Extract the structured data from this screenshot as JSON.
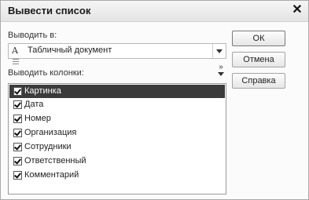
{
  "window": {
    "title": "Вывести список"
  },
  "output": {
    "label": "Выводить в:",
    "value": "Табличный документ",
    "icon": "spreadsheet-doc-icon"
  },
  "columns": {
    "label": "Выводить колонки:",
    "items": [
      {
        "label": "Картинка",
        "checked": true,
        "selected": true
      },
      {
        "label": "Дата",
        "checked": true
      },
      {
        "label": "Номер",
        "checked": true
      },
      {
        "label": "Организация",
        "checked": true
      },
      {
        "label": "Сотрудники",
        "checked": true
      },
      {
        "label": "Ответственный",
        "checked": true
      },
      {
        "label": "Комментарий",
        "checked": true
      }
    ]
  },
  "buttons": {
    "ok": "ОК",
    "cancel": "Отмена",
    "help": "Справка"
  },
  "more_glyph": "»"
}
